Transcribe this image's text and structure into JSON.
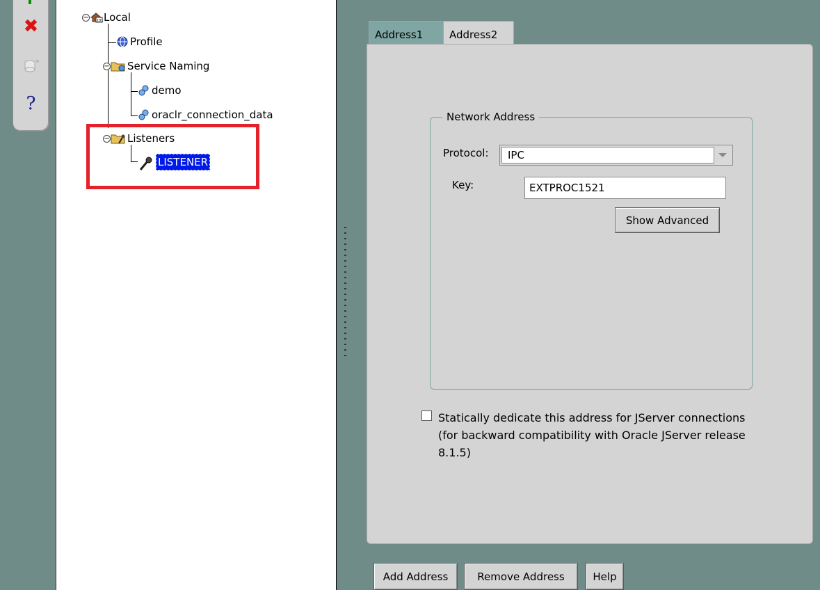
{
  "tree": {
    "items": [
      {
        "label": "Local",
        "icon": "local-icon"
      },
      {
        "label": "Profile",
        "icon": "globe-icon"
      },
      {
        "label": "Service Naming",
        "icon": "folder-icon"
      },
      {
        "label": "demo",
        "icon": "service-icon"
      },
      {
        "label": "oraclr_connection_data",
        "icon": "service-icon"
      },
      {
        "label": "Listeners",
        "icon": "folder-icon"
      },
      {
        "label": "LISTENER",
        "icon": "listener-icon"
      }
    ]
  },
  "tabs": [
    {
      "label": "Address1"
    },
    {
      "label": "Address2"
    }
  ],
  "network_address": {
    "title": "Network Address",
    "protocol_label": "Protocol:",
    "protocol_value": "IPC",
    "key_label": "Key:",
    "key_value": "EXTPROC1521",
    "show_advanced": "Show Advanced"
  },
  "jserver": {
    "line1": "Statically dedicate this address for JServer connections",
    "line2": "(for backward compatibility with Oracle JServer release",
    "line3": "8.1.5)",
    "checked": false
  },
  "buttons": {
    "add_address": "Add Address",
    "remove_address": "Remove Address",
    "help": "Help"
  },
  "colors": {
    "highlight": "#e3222b",
    "selection": "#0018e8",
    "panel_bg": "#6f8c89"
  }
}
